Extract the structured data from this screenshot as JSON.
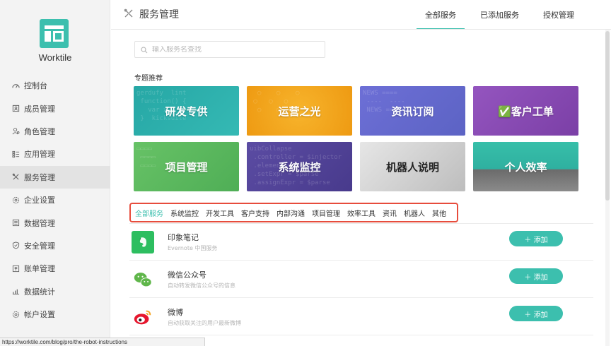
{
  "app": {
    "brand": "Worktile"
  },
  "sidebar": {
    "items": [
      {
        "label": "控制台",
        "icon": "dashboard-icon"
      },
      {
        "label": "成员管理",
        "icon": "member-icon"
      },
      {
        "label": "角色管理",
        "icon": "role-icon"
      },
      {
        "label": "应用管理",
        "icon": "app-icon"
      },
      {
        "label": "服务管理",
        "icon": "service-icon",
        "active": true
      },
      {
        "label": "企业设置",
        "icon": "settings-icon"
      },
      {
        "label": "数据管理",
        "icon": "data-icon"
      },
      {
        "label": "安全管理",
        "icon": "shield-icon"
      },
      {
        "label": "账单管理",
        "icon": "bill-icon"
      },
      {
        "label": "数据统计",
        "icon": "stats-icon"
      },
      {
        "label": "帐户设置",
        "icon": "account-gear-icon"
      }
    ]
  },
  "header": {
    "title": "服务管理",
    "tabs": [
      "全部服务",
      "已添加服务",
      "授权管理"
    ],
    "active_tab": "全部服务"
  },
  "search": {
    "placeholder": "输入服务名查找",
    "value": ""
  },
  "featured": {
    "title": "专题推荐",
    "cards": [
      {
        "label": "研发专供",
        "color": "#2aa9a9"
      },
      {
        "label": "运营之光",
        "color": "#f0a01a"
      },
      {
        "label": "资讯订阅",
        "color": "#6a6fcf"
      },
      {
        "label": "✅客户工单",
        "color": "#8b4fb4"
      },
      {
        "label": "项目管理",
        "color": "#5cb85c"
      },
      {
        "label": "系统监控",
        "color": "#5a4b9e"
      },
      {
        "label": "机器人说明",
        "color": "#c8c8c8"
      },
      {
        "label": "个人效率",
        "color": "#33b3a4"
      }
    ]
  },
  "categories": {
    "items": [
      "全部服务",
      "系统监控",
      "开发工具",
      "客户支持",
      "内部沟通",
      "项目管理",
      "效率工具",
      "资讯",
      "机器人",
      "其他"
    ],
    "active": "全部服务"
  },
  "services": [
    {
      "name": "印象笔记",
      "desc": "Evernote 中国服务",
      "button": "＋ 添加",
      "icon": "evernote-icon",
      "icon_color": "#2dbe60"
    },
    {
      "name": "微信公众号",
      "desc": "自动转发微信公众号的信息",
      "button": "＋ 添加",
      "icon": "wechat-icon",
      "icon_color": "#5fb64a"
    },
    {
      "name": "微博",
      "desc": "自动获取关注的用户最新微博",
      "button": "＋ 添加",
      "icon": "weibo-icon",
      "icon_color": "#e6162d"
    }
  ],
  "statusbar": {
    "url": "https://worktile.com/blog/pro/the-robot-instructions"
  },
  "colors": {
    "accent": "#3cbfae",
    "highlight_border": "#e74c3c"
  }
}
